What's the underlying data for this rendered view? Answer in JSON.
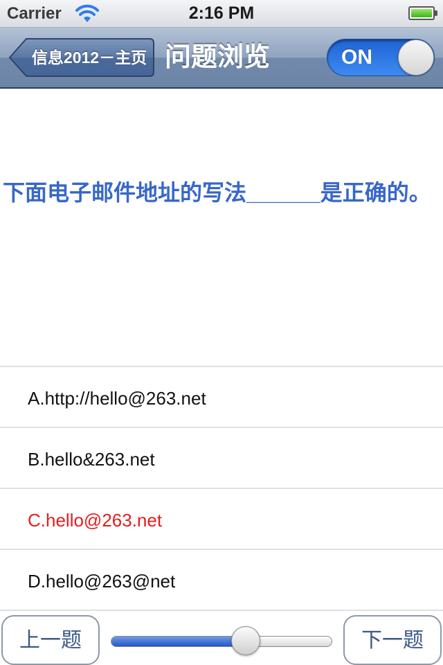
{
  "status_bar": {
    "carrier": "Carrier",
    "time": "2:16 PM",
    "battery_level": 1.0,
    "wifi_icon": "wifi-icon"
  },
  "nav_bar": {
    "back_label": "信息2012－主页",
    "title": "问题浏览",
    "toggle_label": "ON",
    "toggle_on": true
  },
  "question": {
    "text": "下面电子邮件地址的写法______是正确的。"
  },
  "options": [
    {
      "label": "A.http://hello@263.net",
      "correct": false
    },
    {
      "label": "B.hello&263.net",
      "correct": false
    },
    {
      "label": "C.hello@263.net",
      "correct": true
    },
    {
      "label": "D.hello@263@net",
      "correct": false
    }
  ],
  "controls": {
    "prev_label": "上一题",
    "next_label": "下一题",
    "slider_value": 0.61
  },
  "colors": {
    "question": "#3767c9",
    "correct_option": "#e81c1c",
    "toggle_on": "#2a6fe0"
  }
}
